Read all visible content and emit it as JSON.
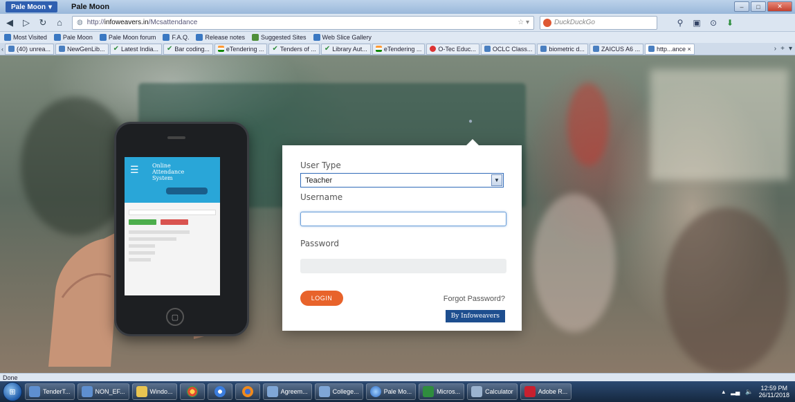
{
  "window": {
    "app_menu": "Pale Moon",
    "title": "Pale Moon"
  },
  "nav": {
    "url_prefix": "http://",
    "url_domain": "infoweavers.in",
    "url_path": "/Mcsattendance",
    "search_placeholder": "DuckDuckGo"
  },
  "bookmarks": [
    "Most Visited",
    "Pale Moon",
    "Pale Moon forum",
    "F.A.Q.",
    "Release notes",
    "Suggested Sites",
    "Web Slice Gallery"
  ],
  "tabs": [
    {
      "label": "(40) unrea...",
      "icon": "mail"
    },
    {
      "label": "NewGenLib...",
      "icon": "google"
    },
    {
      "label": "Latest India...",
      "icon": "check"
    },
    {
      "label": "Bar coding...",
      "icon": "check"
    },
    {
      "label": "eTendering ...",
      "icon": "flag"
    },
    {
      "label": "Tenders of ...",
      "icon": "check"
    },
    {
      "label": "Library Aut...",
      "icon": "check"
    },
    {
      "label": "eTendering ...",
      "icon": "flag"
    },
    {
      "label": "O-Tec Educ...",
      "icon": "red"
    },
    {
      "label": "OCLC Class...",
      "icon": "globe"
    },
    {
      "label": "biometric d...",
      "icon": "google"
    },
    {
      "label": "ZAICUS A6 ...",
      "icon": "page"
    },
    {
      "label": "http...ance ×",
      "icon": "globe",
      "active": true
    }
  ],
  "phone_app": {
    "title_line1": "Online",
    "title_line2": "Attendance",
    "title_line3": "System"
  },
  "login": {
    "user_type_label": "User Type",
    "user_type_value": "Teacher",
    "username_label": "Username",
    "username_value": "",
    "password_label": "Password",
    "password_value": "",
    "login_button": "LOGIN",
    "forgot_link": "Forgot Password?",
    "badge": "By Infoweavers"
  },
  "status": {
    "text": "Done"
  },
  "taskbar": {
    "items": [
      {
        "label": "TenderT...",
        "icon_only": false
      },
      {
        "label": "NON_EF...",
        "icon_only": false
      },
      {
        "label": "Windo...",
        "icon_only": false
      },
      {
        "label": "",
        "icon_only": true
      },
      {
        "label": "",
        "icon_only": true
      },
      {
        "label": "",
        "icon_only": true
      },
      {
        "label": "Agreem...",
        "icon_only": false
      },
      {
        "label": "College...",
        "icon_only": false
      },
      {
        "label": "Pale Mo...",
        "icon_only": false
      },
      {
        "label": "Micros...",
        "icon_only": false
      },
      {
        "label": "Calculator",
        "icon_only": false
      },
      {
        "label": "Adobe R...",
        "icon_only": false
      }
    ],
    "time": "12:59 PM",
    "date": "26/11/2018"
  },
  "colors": {
    "accent": "#e8632b",
    "badge": "#1d4e8f",
    "phone_header": "#29a6d8"
  }
}
